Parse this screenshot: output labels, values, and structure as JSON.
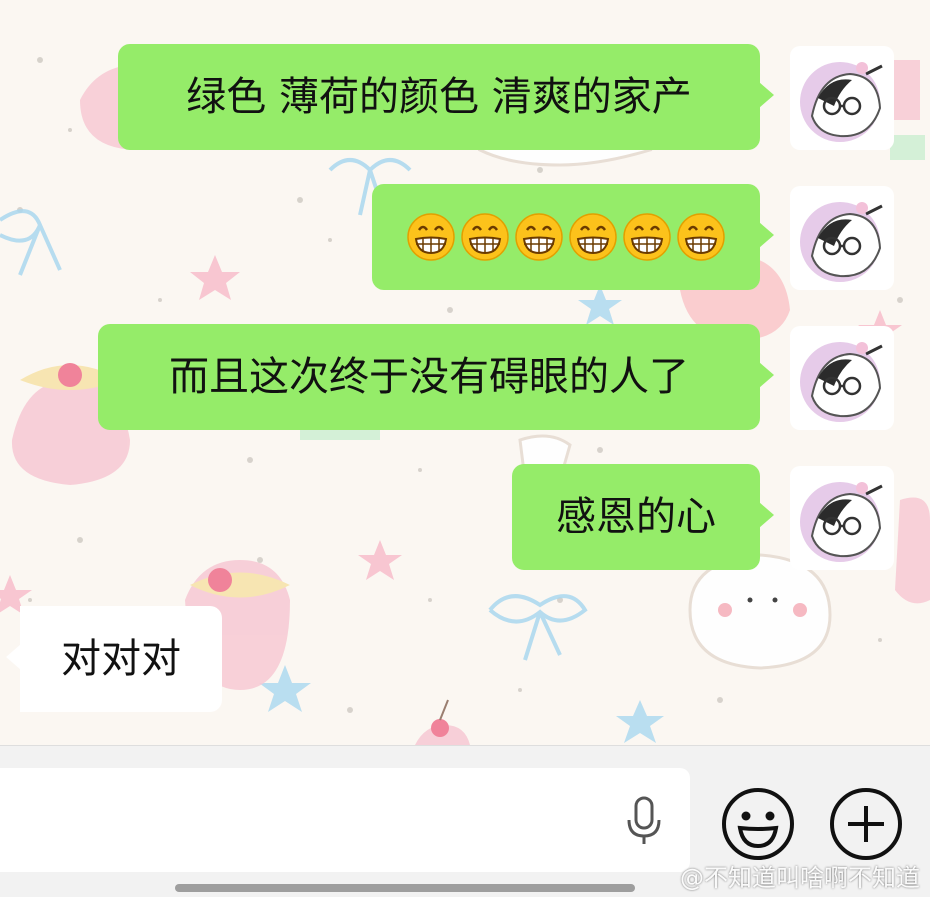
{
  "messages": [
    {
      "direction": "outgoing",
      "text": "绿色 薄荷的颜色 清爽的家产"
    },
    {
      "direction": "outgoing",
      "emoji": "grinning-face",
      "emoji_count": 6
    },
    {
      "direction": "outgoing",
      "text": "而且这次终于没有碍眼的人了"
    },
    {
      "direction": "outgoing",
      "text": "感恩的心"
    },
    {
      "direction": "incoming",
      "text": "对对对"
    }
  ],
  "colors": {
    "outgoing_bubble": "#95ec69",
    "incoming_bubble": "#ffffff",
    "input_bar": "#f2f2f2"
  },
  "input_bar": {
    "value": "",
    "icons": [
      "microphone-icon",
      "emoji-icon",
      "plus-icon"
    ]
  },
  "watermark": "@不知道叫啥啊不知道"
}
